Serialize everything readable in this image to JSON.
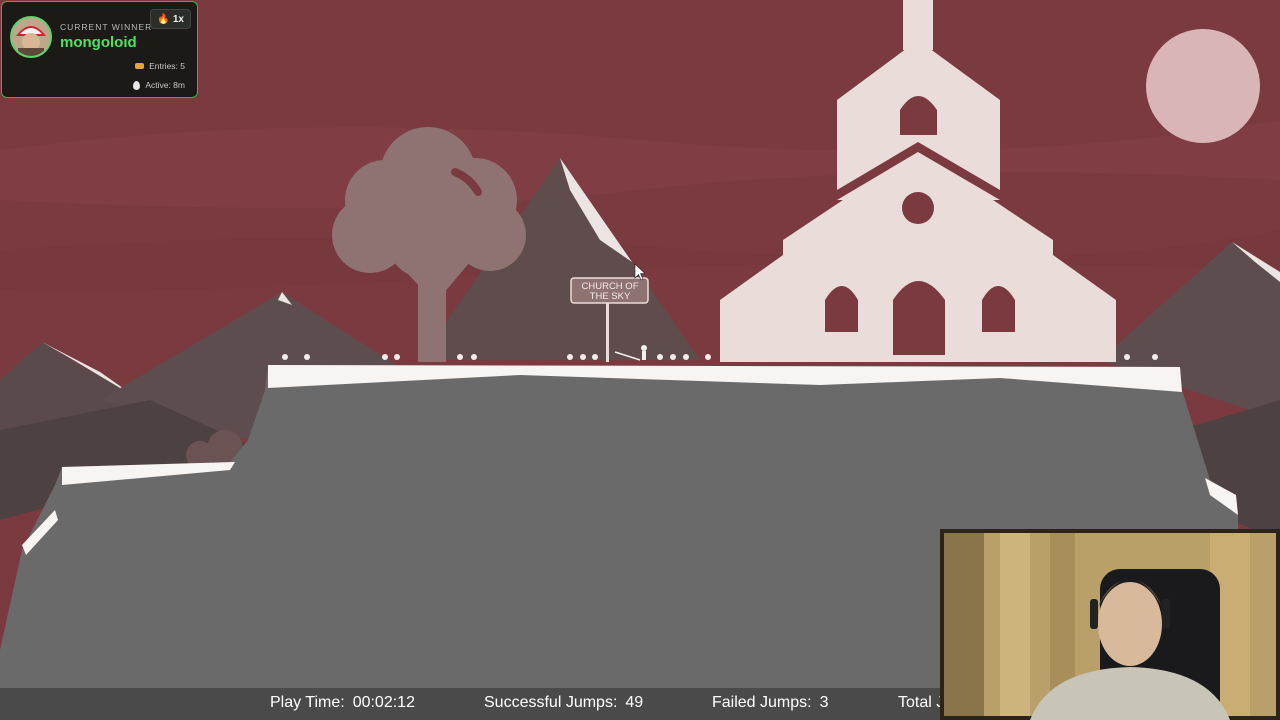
{
  "scene": {
    "sign_text_line1": "CHURCH OF",
    "sign_text_line2": "THE SKY",
    "sky_color": "#7b3a40",
    "building_color": "#e9dcd9",
    "ground_color": "#6a6a6a"
  },
  "winner": {
    "label": "CURRENT WINNER",
    "name": "mongoloid",
    "multiplier": "1x",
    "entries": "Entries: 5",
    "active": "Active: 8m",
    "accent_color": "#52e05f"
  },
  "stats": {
    "play_time_label": "Play Time:",
    "play_time": "00:02:12",
    "successful_jumps_label": "Successful Jumps:",
    "successful_jumps": "49",
    "failed_jumps_label": "Failed Jumps:",
    "failed_jumps": "3",
    "total_label": "Total J"
  },
  "icons": {
    "streak": "flame-icon",
    "entries": "ticket-icon",
    "active": "drop-icon",
    "cursor": "mouse-cursor-icon"
  }
}
